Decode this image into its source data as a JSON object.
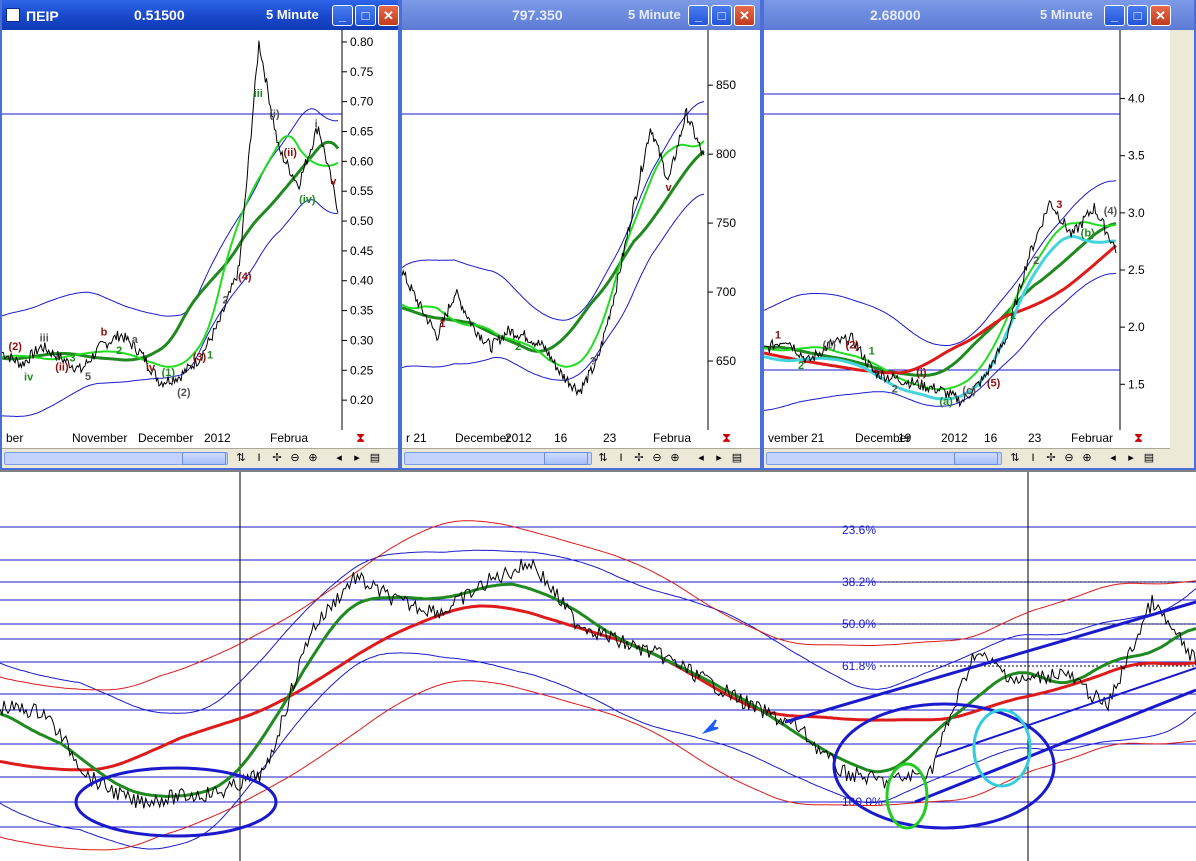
{
  "windows": [
    {
      "symbol": "ΠΕΙΡ",
      "price": "0.51500",
      "interval": "5 Minute",
      "y_ticks": [
        "0.80",
        "0.75",
        "0.70",
        "0.65",
        "0.60",
        "0.55",
        "0.50",
        "0.45",
        "0.40",
        "0.35",
        "0.30",
        "0.25",
        "0.20"
      ],
      "x_labels": [
        "ber",
        "November",
        "December",
        "2012",
        "Februa"
      ],
      "wave_labels": [
        "(2)",
        "iv",
        "iii",
        "(ii)",
        "3",
        "5",
        "b",
        "2",
        "a",
        "iv",
        "(1)",
        "(2)",
        "(3)",
        "1",
        "2",
        "(4)",
        "iii",
        "(i)",
        "(ii)",
        "(iv)",
        "i",
        "v"
      ]
    },
    {
      "symbol": "",
      "price": "797.350",
      "interval": "5 Minute",
      "y_ticks": [
        "850",
        "800",
        "750",
        "700",
        "650"
      ],
      "x_labels": [
        "r 21",
        "December",
        "2012",
        "16",
        "23",
        "Februa"
      ],
      "wave_labels": [
        "1",
        "2",
        "?",
        "v"
      ]
    },
    {
      "symbol": "",
      "price": "2.68000",
      "interval": "5 Minute",
      "y_ticks": [
        "4.0",
        "3.5",
        "3.0",
        "2.5",
        "2.0",
        "1.5"
      ],
      "x_labels": [
        "vember",
        "21",
        "December",
        "19",
        "2012",
        "16",
        "23",
        "Februar"
      ],
      "wave_labels": [
        "1",
        "2",
        "(1)",
        "(2)",
        "1",
        "2",
        "(i)",
        "(a)",
        "(c)",
        "(5)",
        "1",
        "2",
        "3",
        "(b)",
        "(4)"
      ]
    }
  ],
  "main_chart": {
    "fib_labels": [
      "23.6%",
      "38.2%",
      "50.0%",
      "61.8%",
      "100.0%"
    ]
  },
  "colors": {
    "price": "#000000",
    "bollinger": "#1a1acc",
    "ma_green": "#1f8a1f",
    "ma_red": "#dd1b1b",
    "ma_light_green": "#22dd22",
    "ma_cyan": "#44d4dd",
    "title_active": "#1846c8"
  },
  "chart_data": [
    {
      "type": "line",
      "title": "ΠΕΙΡ",
      "ylim": [
        0.15,
        0.82
      ],
      "x": [
        "ber",
        "November",
        "December",
        "2012",
        "Februa"
      ],
      "series": [
        {
          "values": [
            0.28,
            0.26,
            0.29,
            0.27,
            0.25,
            0.29,
            0.31,
            0.28,
            0.23,
            0.24,
            0.27,
            0.33,
            0.42,
            0.8,
            0.62,
            0.56,
            0.66,
            0.52
          ]
        }
      ]
    },
    {
      "type": "line",
      "title": "797.350",
      "ylim": [
        600,
        890
      ],
      "x": [
        "r 21",
        "December",
        "2012",
        "16",
        "23",
        "Februa"
      ],
      "series": [
        {
          "values": [
            715,
            690,
            668,
            700,
            675,
            660,
            672,
            668,
            660,
            640,
            628,
            650,
            700,
            760,
            820,
            780,
            830,
            797
          ]
        }
      ]
    },
    {
      "type": "line",
      "title": "2.68000",
      "ylim": [
        1.1,
        4.6
      ],
      "x": [
        "vember",
        "21",
        "December",
        "19",
        "2012",
        "16",
        "23",
        "Februar"
      ],
      "series": [
        {
          "values": [
            1.8,
            1.9,
            1.7,
            1.85,
            1.9,
            1.6,
            1.55,
            1.5,
            1.45,
            1.35,
            1.55,
            1.9,
            2.6,
            3.1,
            2.8,
            3.05,
            2.68
          ]
        }
      ]
    }
  ]
}
